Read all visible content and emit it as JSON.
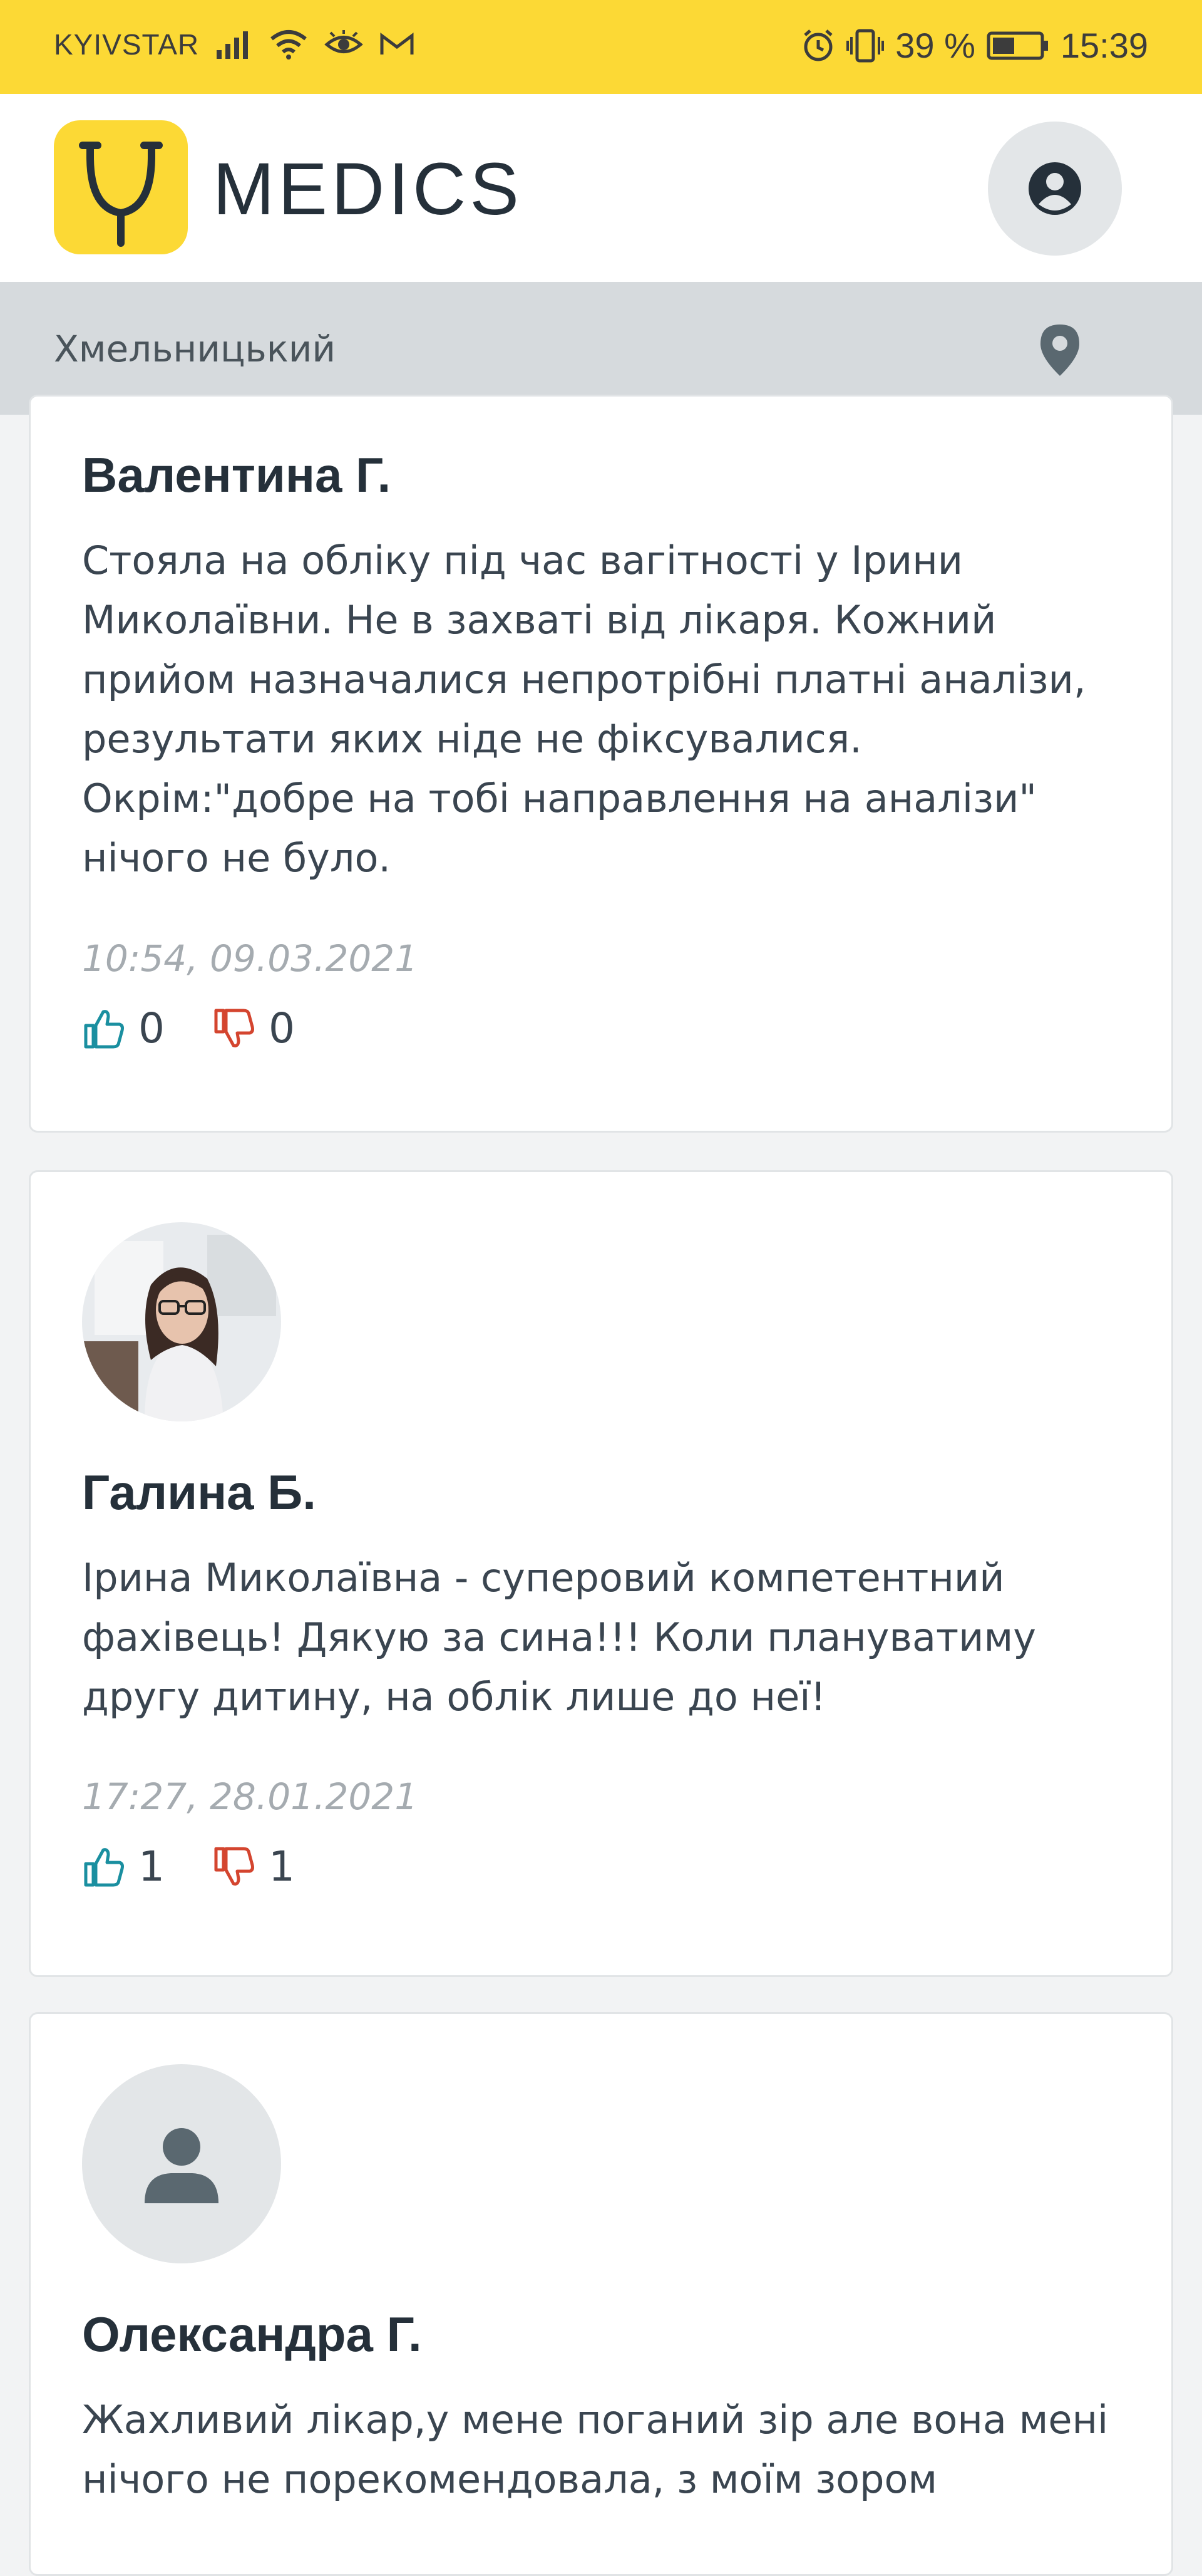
{
  "status_bar": {
    "carrier": "KYIVSTAR",
    "battery": "39 %",
    "time": "15:39"
  },
  "header": {
    "app_name": "MEDICS"
  },
  "location": {
    "city": "Хмельницький"
  },
  "reviews": [
    {
      "author": "Валентина Г.",
      "text": "Стояла на обліку під час вагітності у Ірини Миколаївни. Не в захваті від лікаря. Кожний прийом назначалися непротрібні платні аналізи, результати яких ніде не фіксувалися. Окрім:\"добре на тобі направлення на аналізи\" нічого не було.",
      "date": "10:54, 09.03.2021",
      "likes": "0",
      "dislikes": "0"
    },
    {
      "author": "Галина Б.",
      "text": "Ірина Миколаївна - суперовий компетентний фахівець! Дякую за сина!!! Коли плануватиму другу дитину, на облік лише до неї!",
      "date": "17:27, 28.01.2021",
      "likes": "1",
      "dislikes": "1"
    },
    {
      "author": "Олександра Г.",
      "text": "Жахливий лікар,у мене поганий зір але вона мені нічого не порекомендовала, з моїм зором"
    }
  ],
  "colors": {
    "brand_yellow": "#fcd935",
    "like": "#1a8fa0",
    "dislike": "#d4452f"
  }
}
